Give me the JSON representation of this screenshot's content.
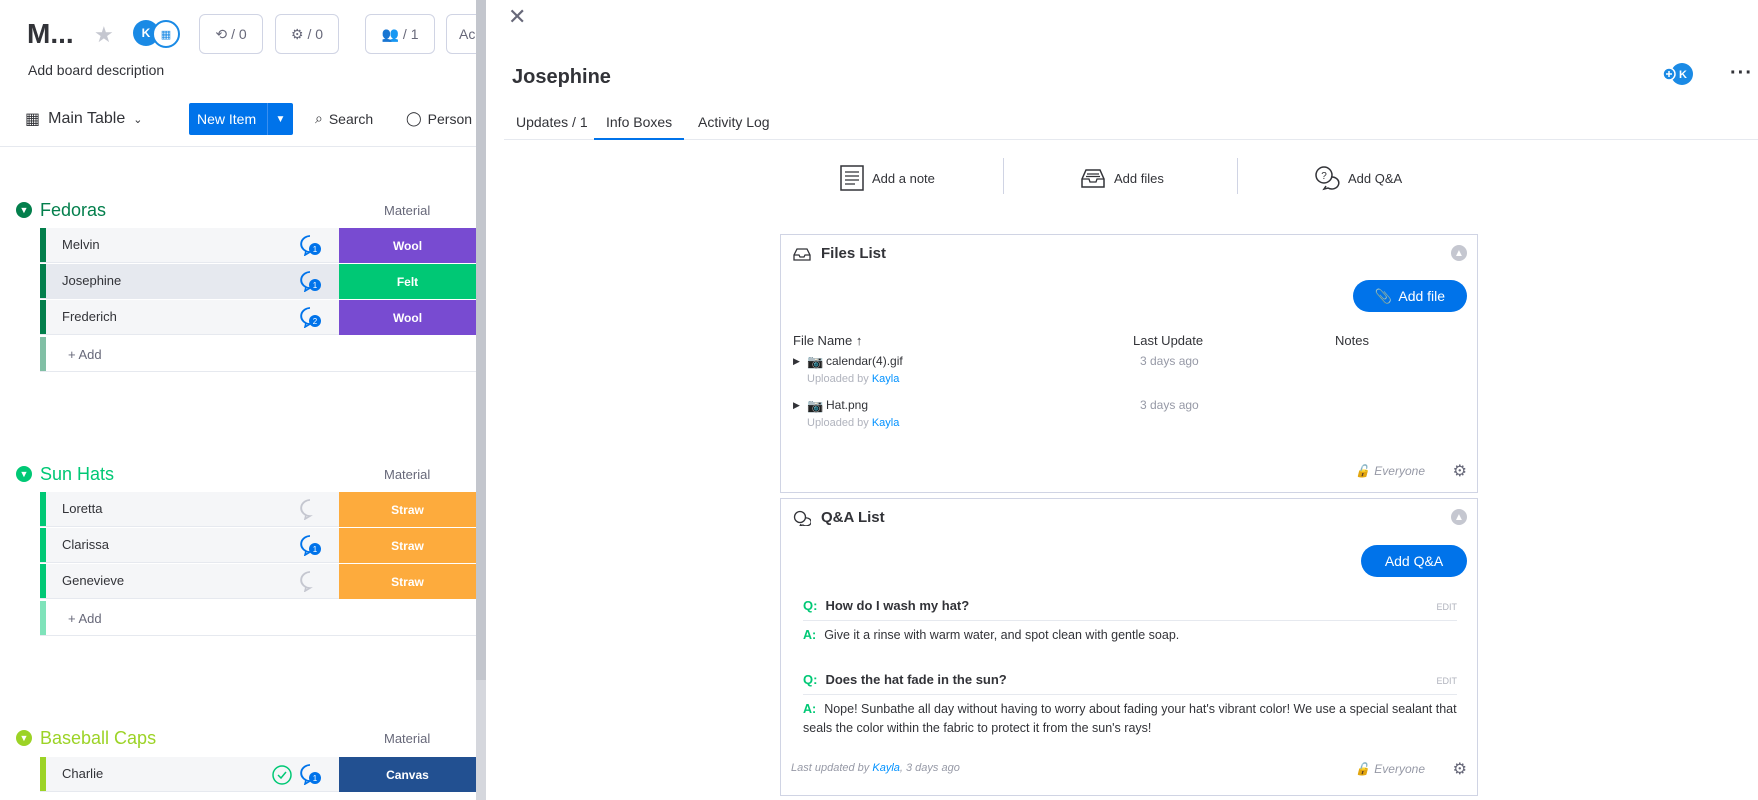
{
  "board": {
    "title": "M...",
    "description": "Add board description",
    "avatar_initial": "K",
    "integrations_count": "/ 0",
    "automations_count": "/ 0",
    "members_count": "/ 1",
    "truncated_button": "Ac",
    "main_table_label": "Main Table",
    "new_item_label": "New Item",
    "search_label": "Search",
    "person_label": "Person"
  },
  "groups": [
    {
      "name": "Fedoras",
      "color": "#037f4c",
      "column_label": "Material",
      "add_label": "+ Add",
      "items": [
        {
          "name": "Melvin",
          "updates": "1",
          "material": "Wool",
          "material_color": "#784bd1"
        },
        {
          "name": "Josephine",
          "updates": "1",
          "material": "Felt",
          "material_color": "#00c875"
        },
        {
          "name": "Frederich",
          "updates": "2",
          "material": "Wool",
          "material_color": "#784bd1"
        }
      ]
    },
    {
      "name": "Sun Hats",
      "color": "#00c875",
      "column_label": "Material",
      "add_label": "+ Add",
      "items": [
        {
          "name": "Loretta",
          "updates": "",
          "material": "Straw",
          "material_color": "#fdab3d"
        },
        {
          "name": "Clarissa",
          "updates": "1",
          "material": "Straw",
          "material_color": "#fdab3d"
        },
        {
          "name": "Genevieve",
          "updates": "",
          "material": "Straw",
          "material_color": "#fdab3d"
        }
      ]
    },
    {
      "name": "Baseball Caps",
      "color": "#9cd326",
      "column_label": "Material",
      "items": [
        {
          "name": "Charlie",
          "updates": "1",
          "material": "Canvas",
          "material_color": "#225091"
        }
      ]
    }
  ],
  "panel": {
    "title": "Josephine",
    "avatar_initial": "K",
    "tabs": [
      "Updates / 1",
      "Info Boxes",
      "Activity Log"
    ],
    "active_tab": "Info Boxes",
    "actions": {
      "add_note": "Add a note",
      "add_files": "Add files",
      "add_qa": "Add Q&A"
    }
  },
  "files_list": {
    "title": "Files List",
    "add_button": "Add file",
    "columns": {
      "name": "File Name",
      "sort_indicator": "↑",
      "last_update": "Last Update",
      "notes": "Notes"
    },
    "files": [
      {
        "name": "calendar(4).gif",
        "uploaded_prefix": "Uploaded by",
        "uploader": "Kayla",
        "last_update": "3 days ago"
      },
      {
        "name": "Hat.png",
        "uploaded_prefix": "Uploaded by",
        "uploader": "Kayla",
        "last_update": "3 days ago"
      }
    ],
    "visibility": "Everyone"
  },
  "qa_list": {
    "title": "Q&A List",
    "add_button": "Add Q&A",
    "q_prefix": "Q:",
    "a_prefix": "A:",
    "edit_label": "EDIT",
    "items": [
      {
        "question": "How do I wash my hat?",
        "answer": "Give it a rinse with warm water, and spot clean with gentle soap."
      },
      {
        "question": "Does the hat fade in the sun?",
        "answer": "Nope! Sunbathe all day without having to worry about fading your hat's vibrant color! We use a special sealant that seals the color within the fabric to protect it from the sun's rays!"
      }
    ],
    "last_updated_prefix": "Last updated by",
    "last_updated_by": "Kayla",
    "last_updated_when": ", 3 days ago",
    "visibility": "Everyone"
  },
  "colors": {
    "accent": "#0073ea",
    "qa_green": "#00c875",
    "link_blue": "#0091ff"
  }
}
